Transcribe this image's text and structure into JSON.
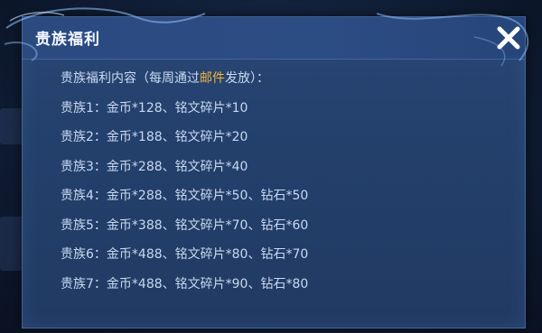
{
  "dialog": {
    "title": "贵族福利",
    "close_icon": "close-icon",
    "intro": {
      "prefix": "贵族福利内容（每周通过",
      "highlight": "邮件",
      "suffix": "发放）：",
      "highlight_color": "#f3b23a"
    },
    "rewards": [
      "贵族1：金币*128、铭文碎片*10",
      "贵族2：金币*188、铭文碎片*20",
      "贵族3：金币*288、铭文碎片*40",
      "贵族4：金币*288、铭文碎片*50、钻石*50",
      "贵族5：金币*388、铭文碎片*70、钻石*60",
      "贵族6：金币*488、铭文碎片*80、钻石*70",
      "贵族7：金币*488、铭文碎片*90、钻石*80"
    ]
  },
  "colors": {
    "panel": "#23406c",
    "text": "#c9d8f0",
    "title": "#f2f6ff"
  }
}
